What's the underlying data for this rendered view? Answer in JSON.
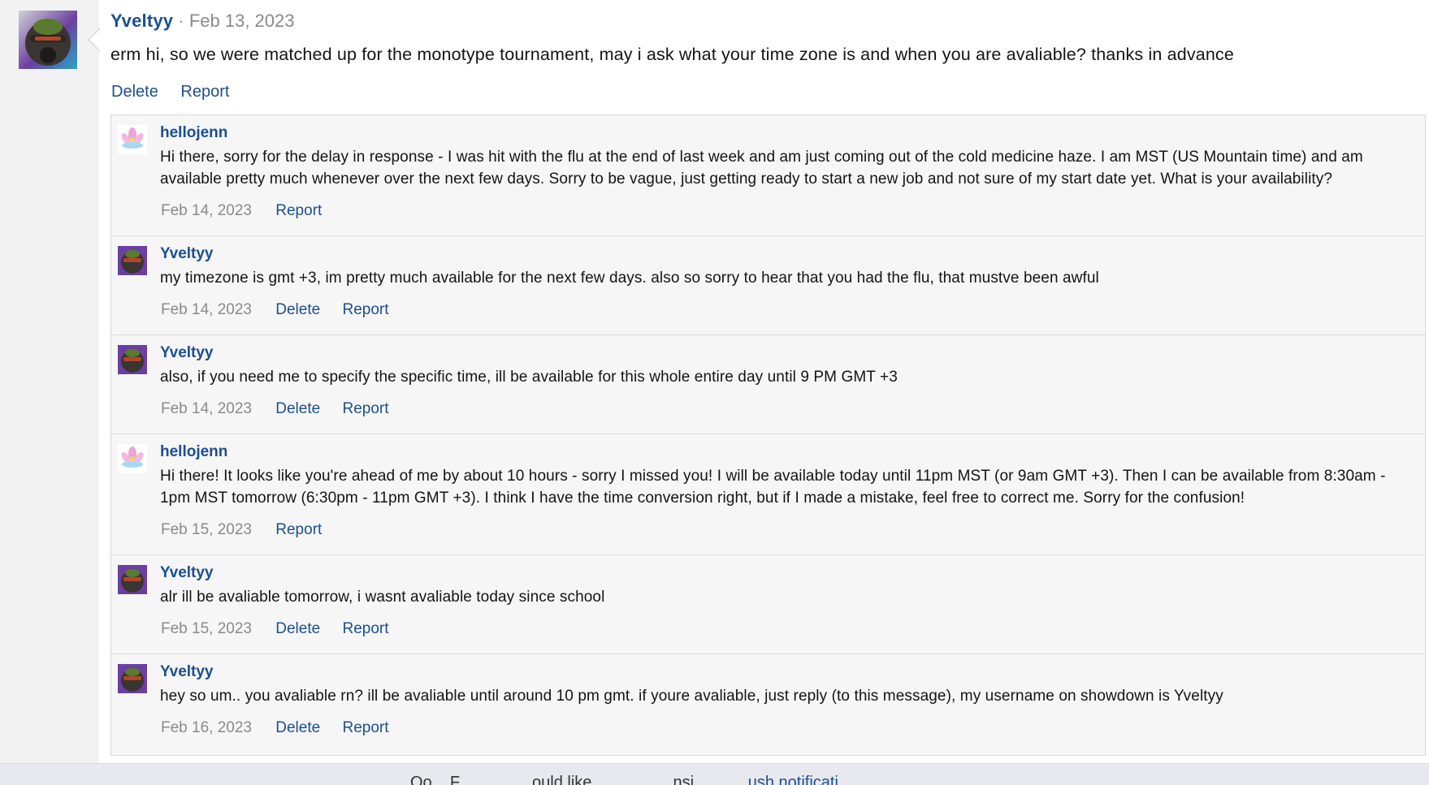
{
  "post": {
    "username": "Yveltyy",
    "separator": "·",
    "date": "Feb 13, 2023",
    "text": "erm hi, so we were matched up for the monotype tournament, may i ask what your time zone is and when you are avaliable? thanks in advance",
    "delete_label": "Delete",
    "report_label": "Report"
  },
  "comments": [
    {
      "username": "hellojenn",
      "avatar": "lotus-avatar",
      "text": "Hi there, sorry for the delay in response - I was hit with the flu at the end of last week and am just coming out of the cold medicine haze. I am MST (US Mountain time) and am available pretty much whenever over the next few days. Sorry to be vague, just getting ready to start a new job and not sure of my start date yet. What is your availability?",
      "date": "Feb 14, 2023",
      "report_label": "Report"
    },
    {
      "username": "Yveltyy",
      "avatar": "robot-avatar",
      "text": "my timezone is gmt +3, im pretty much available for the next few days. also so sorry to hear that you had the flu, that mustve been awful",
      "date": "Feb 14, 2023",
      "delete_label": "Delete",
      "report_label": "Report"
    },
    {
      "username": "Yveltyy",
      "avatar": "robot-avatar",
      "text": "also, if you need me to specify the specific time, ill be available for this whole entire day until 9 PM GMT +3",
      "date": "Feb 14, 2023",
      "delete_label": "Delete",
      "report_label": "Report"
    },
    {
      "username": "hellojenn",
      "avatar": "lotus-avatar",
      "text": "Hi there! It looks like you're ahead of me by about 10 hours - sorry I missed you! I will be available today until 11pm MST (or 9am GMT +3). Then I can be available from 8:30am - 1pm MST tomorrow (6:30pm - 11pm GMT +3). I think I have the time conversion right, but if I made a mistake, feel free to correct me. Sorry for the confusion!",
      "date": "Feb 15, 2023",
      "report_label": "Report"
    },
    {
      "username": "Yveltyy",
      "avatar": "robot-avatar",
      "text": "alr ill be avaliable tomorrow, i wasnt avaliable today since school",
      "date": "Feb 15, 2023",
      "delete_label": "Delete",
      "report_label": "Report"
    },
    {
      "username": "Yveltyy",
      "avatar": "robot-avatar",
      "text": "hey so um.. you avaliable rn? ill be avaliable until around 10 pm gmt. if youre avaliable, just reply (to this message), my username on showdown is Yveltyy",
      "date": "Feb 16, 2023",
      "delete_label": "Delete",
      "report_label": "Report"
    }
  ],
  "bottom_banner": {
    "text_start": "Oo",
    "text_mid": "F",
    "text_rest": "ould like",
    "text_tail": "nsi",
    "link_text": "ush notificati"
  },
  "colors": {
    "link": "#1c4f90",
    "muted": "#8a8a8a",
    "comment_bg": "#f6f6f6"
  }
}
